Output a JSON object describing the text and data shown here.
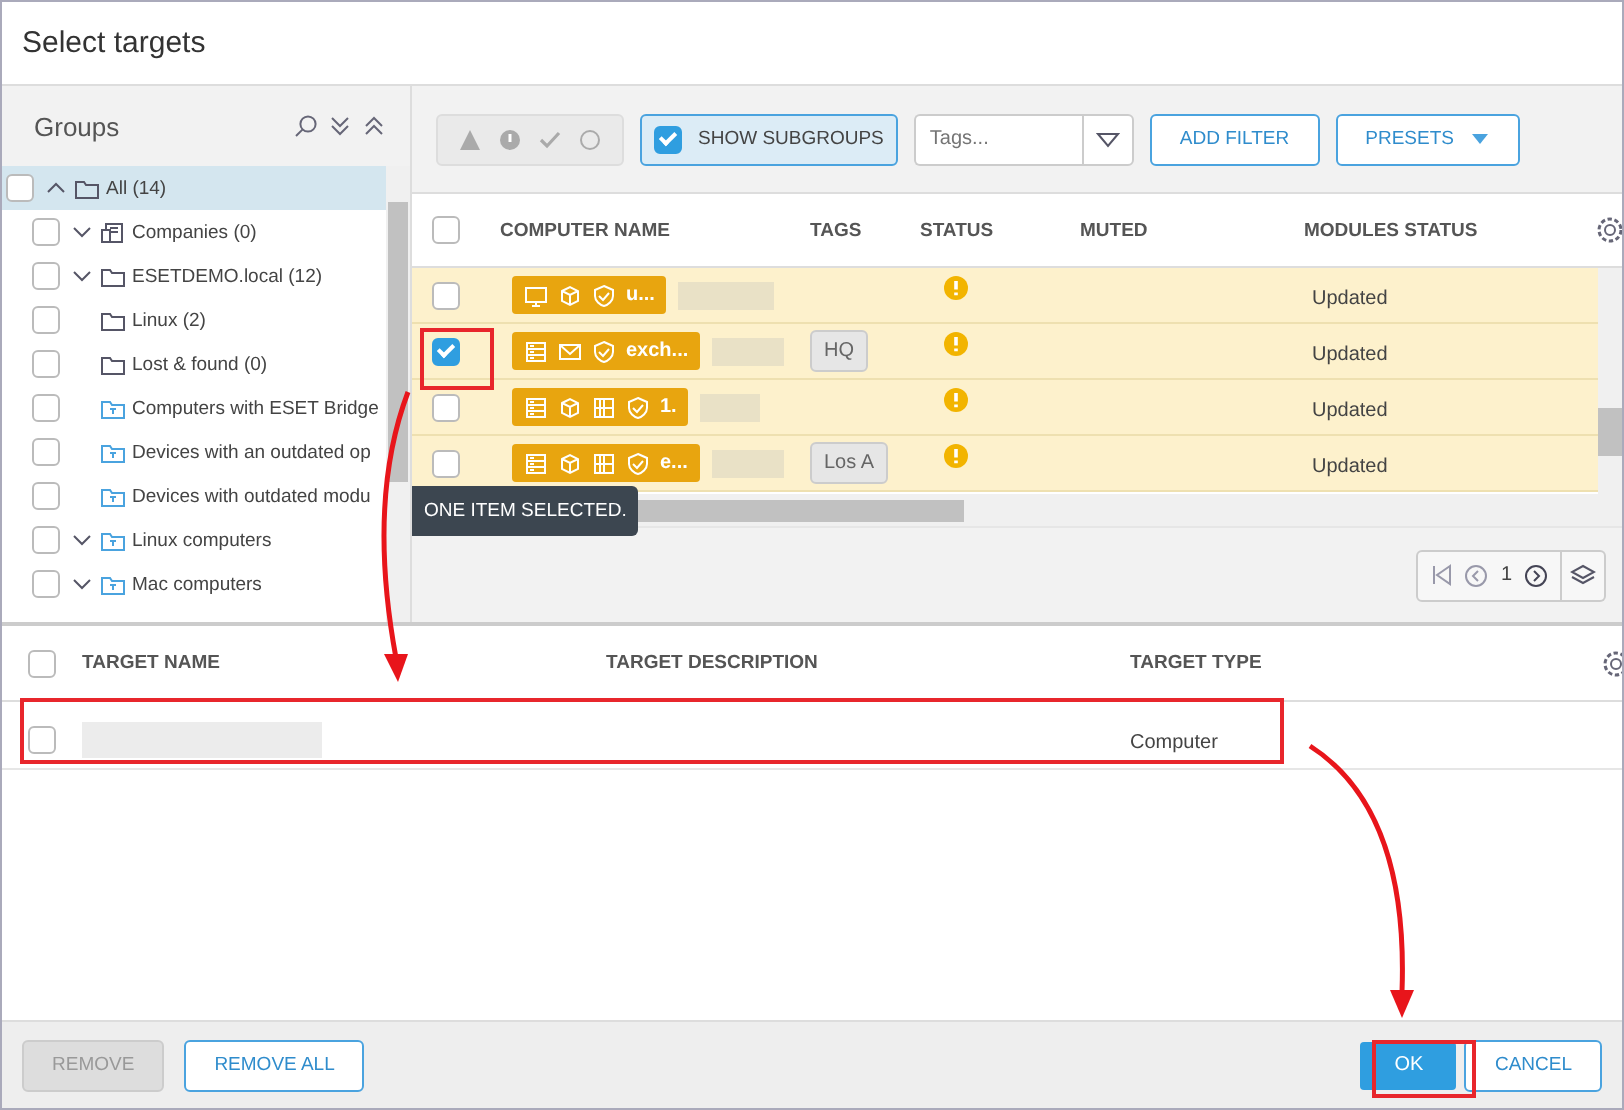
{
  "window": {
    "title": "Select targets"
  },
  "groups": {
    "title": "Groups",
    "items": [
      {
        "label": "All (14)",
        "kind": "static",
        "expanded": true,
        "checked": false,
        "selected": true,
        "children": [
          {
            "label": "Companies (0)",
            "kind": "company",
            "expanded": false,
            "checked": false,
            "selected": false
          },
          {
            "label": "ESETDEMO.local (12)",
            "kind": "static",
            "expanded": false,
            "checked": false,
            "selected": false
          },
          {
            "label": "Linux (2)",
            "kind": "static",
            "checked": false,
            "selected": false
          },
          {
            "label": "Lost & found (0)",
            "kind": "static",
            "checked": false,
            "selected": false
          },
          {
            "label": "Computers with ESET Bridge",
            "kind": "dynamic",
            "checked": false,
            "selected": false
          },
          {
            "label": "Devices with an outdated op",
            "kind": "dynamic",
            "checked": false,
            "selected": false
          },
          {
            "label": "Devices with outdated modu",
            "kind": "dynamic",
            "checked": false,
            "selected": false
          },
          {
            "label": "Linux computers",
            "kind": "dynamic",
            "expanded": false,
            "checked": false,
            "selected": false
          },
          {
            "label": "Mac computers",
            "kind": "dynamic",
            "expanded": false,
            "checked": false,
            "selected": false
          }
        ]
      }
    ]
  },
  "toolbar": {
    "status_filters": [
      {
        "kind": "warning"
      },
      {
        "kind": "error"
      },
      {
        "kind": "ok"
      },
      {
        "kind": "none"
      }
    ],
    "show_subgroups": {
      "label": "SHOW SUBGROUPS",
      "checked": true
    },
    "tags": {
      "placeholder": "Tags..."
    },
    "add_filter": "ADD FILTER",
    "presets": "PRESETS"
  },
  "computers": {
    "all_checked": false,
    "columns": [
      "COMPUTER NAME",
      "TAGS",
      "STATUS",
      "MUTED",
      "MODULES STATUS"
    ],
    "rows": [
      {
        "selected": false,
        "icons": [
          {
            "kind": "monitor"
          },
          {
            "kind": "box"
          },
          {
            "kind": "shield"
          }
        ],
        "name": "u...",
        "status_icon": {
          "kind": "warning"
        },
        "modules_status": "Updated"
      },
      {
        "selected": true,
        "icons": [
          {
            "kind": "server"
          },
          {
            "kind": "mail"
          },
          {
            "kind": "shield"
          }
        ],
        "name": "exch...",
        "tag": "HQ",
        "status_icon": {
          "kind": "warning"
        },
        "modules_status": "Updated"
      },
      {
        "selected": false,
        "icons": [
          {
            "kind": "server"
          },
          {
            "kind": "box"
          },
          {
            "kind": "grid"
          },
          {
            "kind": "shield"
          }
        ],
        "name": "1.",
        "status_icon": {
          "kind": "warning"
        },
        "modules_status": "Updated"
      },
      {
        "selected": false,
        "icons": [
          {
            "kind": "server"
          },
          {
            "kind": "box"
          },
          {
            "kind": "grid"
          },
          {
            "kind": "shield"
          }
        ],
        "name": "e...",
        "tag": "Los A",
        "status_icon": {
          "kind": "warning"
        },
        "modules_status": "Updated"
      }
    ],
    "selection_note": "ONE ITEM SELECTED.",
    "page": "1"
  },
  "targets": {
    "all_checked": false,
    "columns": [
      "TARGET NAME",
      "TARGET DESCRIPTION",
      "TARGET TYPE"
    ],
    "rows": [
      {
        "checked": false,
        "type": "Computer"
      }
    ]
  },
  "footer": {
    "remove": {
      "label": "REMOVE",
      "disabled": true
    },
    "remove_all": {
      "label": "REMOVE ALL",
      "disabled": false
    },
    "ok": "OK",
    "cancel": "CANCEL"
  }
}
